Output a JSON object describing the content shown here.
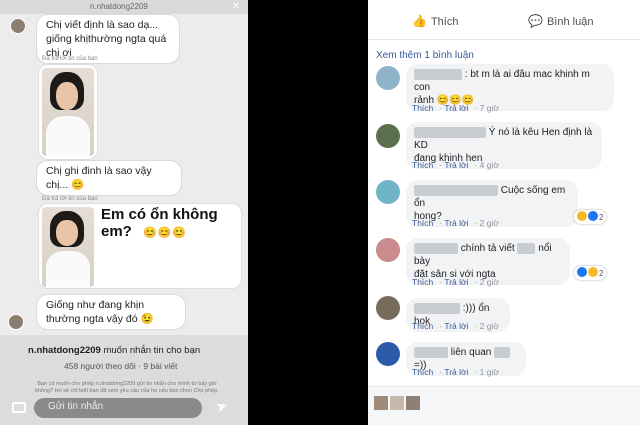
{
  "instagram": {
    "handle": "n.nhatdong2209",
    "messages": [
      {
        "text": "Chị viết định là sao dạ... giống khịthường ngta quá chị ơi"
      },
      {
        "text": "Chị ghi đinh là sao vậy chị... 😊"
      },
      {
        "text": "Giống như đang khịn thường ngta vậy đó 😉"
      }
    ],
    "reply_label": "Đã trả lời tin của bạn",
    "card_question": "Em có ổn không em?",
    "card_emoji": "😊😊😊",
    "request": {
      "name": "n.nhatdong2209",
      "suffix": "muốn nhắn tin cho bạn",
      "stats": "458 người theo dõi · 9 bài viết",
      "note": "Bạn có muốn cho phép n.nhatdong2209 gửi tin nhắn cho mình từ bây giờ không? Họ sẽ chỉ biết bạn đã xem yêu cầu của họ nếu bạn chọn Cho phép."
    },
    "send_placeholder": "Gửi tin nhắn"
  },
  "facebook": {
    "actions": {
      "like": "Thích",
      "comment": "Bình luận"
    },
    "see_more": "Xem thêm 1 bình luận",
    "comment_actions": {
      "like": "Thích",
      "reply": "Trả lời"
    },
    "comments": [
      {
        "line1": ": bt m là ai đâu mac khinh m con",
        "line2": "rảnh 😊😊😊",
        "time": "7 giờ",
        "avatar_color": "#8fb3c9"
      },
      {
        "line1": "Ý nó là kêu Hen định là KD",
        "line2": "đang khinh hen",
        "time": "4 giờ",
        "avatar_color": "#5b6e4e"
      },
      {
        "line1": "Cuộc sống em ổn",
        "line2": "hong?",
        "time": "2 giờ",
        "avatar_color": "#6fb3c7",
        "reactions": "2"
      },
      {
        "line1": "chính tả viết",
        "line1b": "nổi bày",
        "line2": "đặt sân si với ngta",
        "time": "2 giờ",
        "avatar_color": "#c98b8b",
        "reactions": "2"
      },
      {
        "line1": ":))) ổn hok",
        "time": "2 giờ",
        "avatar_color": "#7a6c5c"
      },
      {
        "line1": "liên quan",
        "line1b": "=))",
        "time": "1 giờ",
        "avatar_color": "#2b5aa8"
      }
    ],
    "accent": "#385898"
  }
}
